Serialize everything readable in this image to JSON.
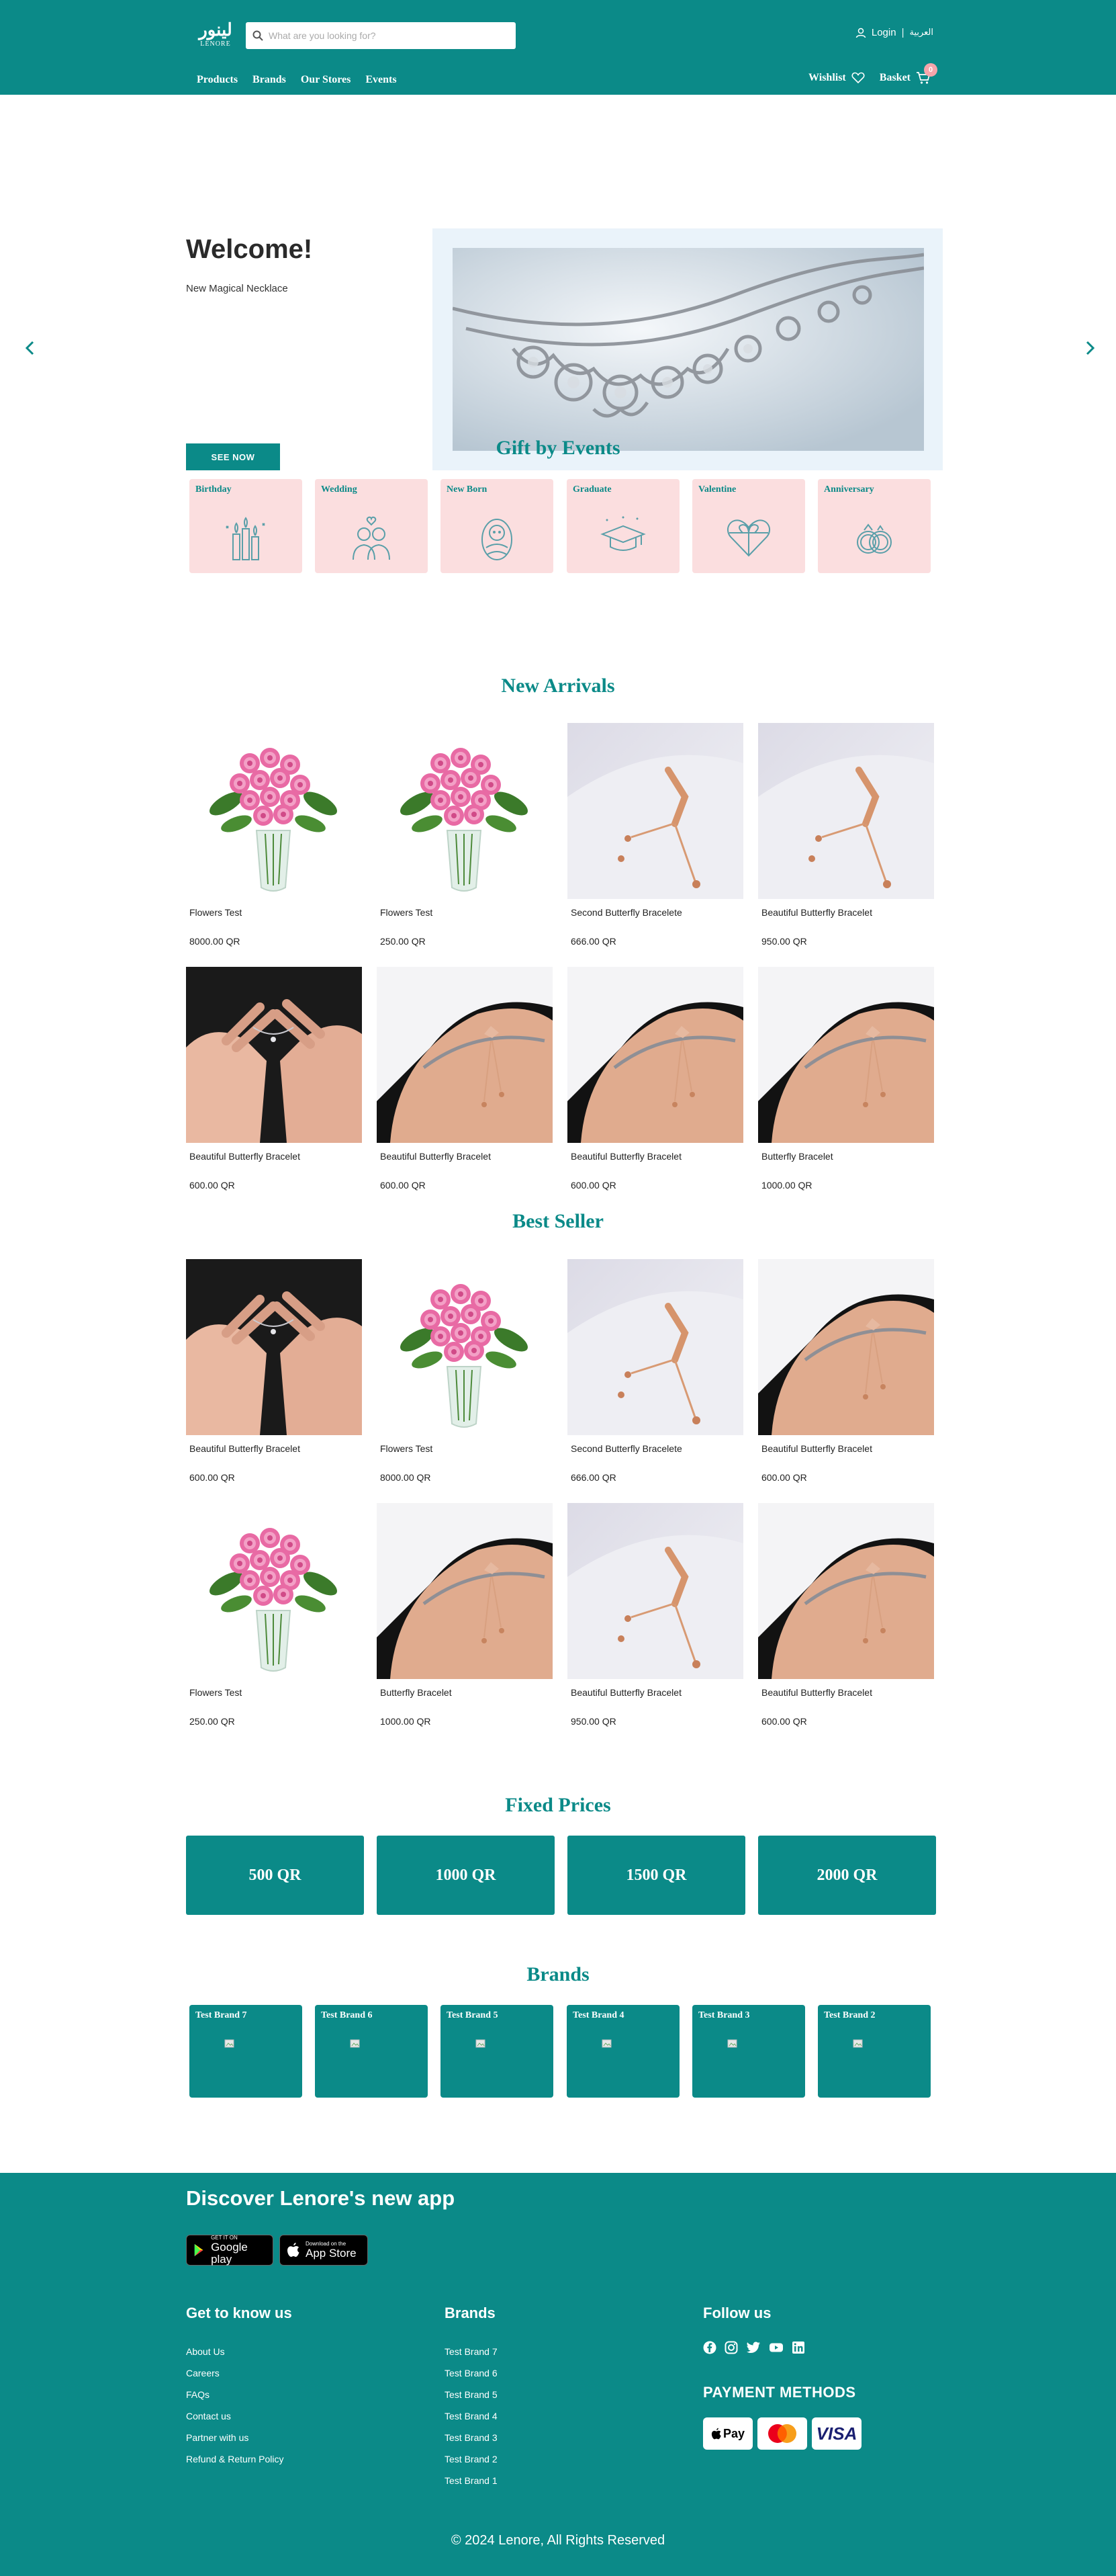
{
  "header": {
    "logo_ar": "لينور",
    "logo_en": "LENORE",
    "search_placeholder": "What are you looking for?",
    "login": "Login",
    "separator": "|",
    "language": "العربية",
    "nav": [
      "Products",
      "Brands",
      "Our Stores",
      "Events"
    ],
    "wishlist": "Wishlist",
    "basket": "Basket",
    "basket_count": "0"
  },
  "hero": {
    "title": "Welcome!",
    "subtitle": "New Magical Necklace",
    "button": "SEE NOW"
  },
  "gift_events": {
    "title": "Gift by Events",
    "items": [
      {
        "label": "Birthday",
        "icon": "candles-icon"
      },
      {
        "label": "Wedding",
        "icon": "couple-icon"
      },
      {
        "label": "New Born",
        "icon": "baby-icon"
      },
      {
        "label": "Graduate",
        "icon": "graduation-cap-icon"
      },
      {
        "label": "Valentine",
        "icon": "heart-gift-icon"
      },
      {
        "label": "Anniversary",
        "icon": "rings-icon"
      }
    ]
  },
  "new_arrivals": {
    "title": "New Arrivals",
    "products": [
      {
        "name": "Flowers Test",
        "price": "8000.00 QR",
        "image": "flowers"
      },
      {
        "name": "Flowers Test",
        "price": "250.00 QR",
        "image": "flowers"
      },
      {
        "name": "Second Butterfly Bracelete",
        "price": "666.00 QR",
        "image": "bracelet-white"
      },
      {
        "name": "Beautiful Butterfly Bracelet",
        "price": "950.00 QR",
        "image": "bracelet-white"
      },
      {
        "name": "Beautiful Butterfly Bracelet",
        "price": "600.00 QR",
        "image": "hands"
      },
      {
        "name": "Beautiful Butterfly Bracelet",
        "price": "600.00 QR",
        "image": "wrist"
      },
      {
        "name": "Beautiful Butterfly Bracelet",
        "price": "600.00 QR",
        "image": "wrist"
      },
      {
        "name": "Butterfly Bracelet",
        "price": "1000.00 QR",
        "image": "wrist"
      }
    ]
  },
  "best_seller": {
    "title": "Best Seller",
    "products": [
      {
        "name": "Beautiful Butterfly Bracelet",
        "price": "600.00 QR",
        "image": "hands"
      },
      {
        "name": "Flowers Test",
        "price": "8000.00 QR",
        "image": "flowers"
      },
      {
        "name": "Second Butterfly Bracelete",
        "price": "666.00 QR",
        "image": "bracelet-white"
      },
      {
        "name": "Beautiful Butterfly Bracelet",
        "price": "600.00 QR",
        "image": "wrist"
      },
      {
        "name": "Flowers Test",
        "price": "250.00 QR",
        "image": "flowers"
      },
      {
        "name": "Butterfly Bracelet",
        "price": "1000.00 QR",
        "image": "wrist"
      },
      {
        "name": "Beautiful Butterfly Bracelet",
        "price": "950.00 QR",
        "image": "bracelet-white"
      },
      {
        "name": "Beautiful Butterfly Bracelet",
        "price": "600.00 QR",
        "image": "wrist"
      }
    ]
  },
  "fixed_prices": {
    "title": "Fixed Prices",
    "items": [
      "500 QR",
      "1000 QR",
      "1500 QR",
      "2000 QR"
    ]
  },
  "brands": {
    "title": "Brands",
    "items": [
      "Test Brand 7",
      "Test Brand 6",
      "Test Brand 5",
      "Test Brand 4",
      "Test Brand 3",
      "Test Brand 2"
    ]
  },
  "footer": {
    "app_title": "Discover Lenore's new app",
    "google_small": "GET IT ON",
    "google_big": "Google play",
    "apple_small": "Download on the",
    "apple_big": "App Store",
    "get_to_know": {
      "title": "Get to know us",
      "links": [
        "About Us",
        "Careers",
        "FAQs",
        "Contact us",
        "Partner with us",
        "Refund & Return Policy"
      ]
    },
    "brands": {
      "title": "Brands",
      "links": [
        "Test Brand 7",
        "Test Brand 6",
        "Test Brand 5",
        "Test Brand 4",
        "Test Brand 3",
        "Test Brand 2",
        "Test Brand 1"
      ]
    },
    "follow_us": "Follow us",
    "social": [
      "facebook-icon",
      "instagram-icon",
      "twitter-icon",
      "youtube-icon",
      "linkedin-icon"
    ],
    "payment_title": "PAYMENT METHODS",
    "payments": {
      "applepay": "Pay",
      "visa": "VISA"
    },
    "copyright": "© 2024 Lenore, All Rights Reserved"
  },
  "colors": {
    "primary": "#0b8a88",
    "event_bg": "#fbdedf",
    "badge": "#f6a5ab"
  }
}
